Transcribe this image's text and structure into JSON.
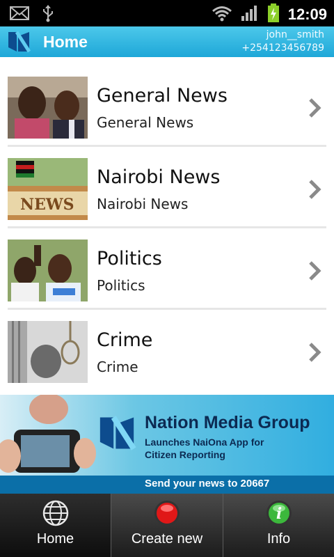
{
  "status_bar": {
    "time": "12:09",
    "icons": [
      "email-icon",
      "usb-icon",
      "wifi-icon",
      "signal-icon",
      "battery-icon"
    ]
  },
  "app_bar": {
    "title": "Home",
    "username": "john__smith",
    "phone": "+254123456789",
    "accent": "#1ea7d8"
  },
  "categories": [
    {
      "title": "General News",
      "subtitle": "General News"
    },
    {
      "title": "Nairobi News",
      "subtitle": "Nairobi News"
    },
    {
      "title": "Politics",
      "subtitle": "Politics"
    },
    {
      "title": "Crime",
      "subtitle": "Crime"
    }
  ],
  "banner": {
    "brand": "Nation Media Group",
    "line1": "Launches NaiOna App for",
    "line2": "Citizen Reporting",
    "footer": "Send your news to 20667"
  },
  "bottom_nav": {
    "home": "Home",
    "create_new": "Create new",
    "info": "Info"
  }
}
